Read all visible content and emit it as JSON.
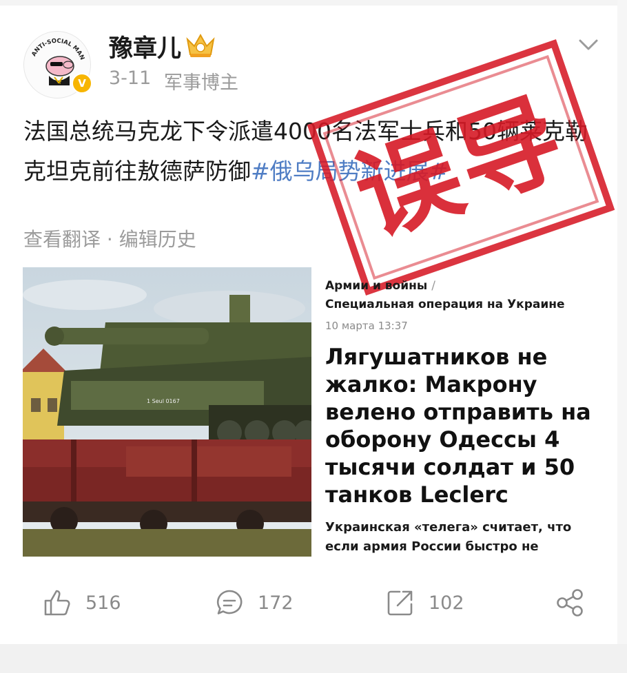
{
  "post": {
    "username": "豫章儿",
    "date": "3-11",
    "role": "军事博主",
    "text_main": "法国总统马克龙下令派遣4000名法军士兵和50辆莱克勒克坦克前往敖德萨防御",
    "hashtag": "#俄乌局势新进展#",
    "translate_link": "查看翻译 · 编辑历史",
    "stamp_label": "误导",
    "avatar_caption": "ANTI-SOCIAL MAN",
    "verified_mark": "V"
  },
  "article": {
    "breadcrumb_1": "Армии и войны",
    "breadcrumb_sep": "/",
    "breadcrumb_2": "Специальная операция на Украине",
    "date": "10 марта 13:37",
    "headline": "Лягушатников не жалко: Макрону велено отправить на оборону Одессы 4 тысячи солдат и 50 танков Leclerc",
    "lead": "Украинская «телега» считает, что если армия России быстро не"
  },
  "photo": {
    "vehicle_marking": "1 Seul 0167"
  },
  "actions": {
    "like_count": "516",
    "comment_count": "172",
    "repost_count": "102"
  },
  "icons": [
    "chevron-down-icon",
    "crown-icon",
    "thumbs-up-icon",
    "comment-icon",
    "share-icon",
    "forward-icon"
  ],
  "colors": {
    "hashtag": "#4f7dc4",
    "stamp": "#d61926",
    "meta": "#9b9b9b"
  }
}
